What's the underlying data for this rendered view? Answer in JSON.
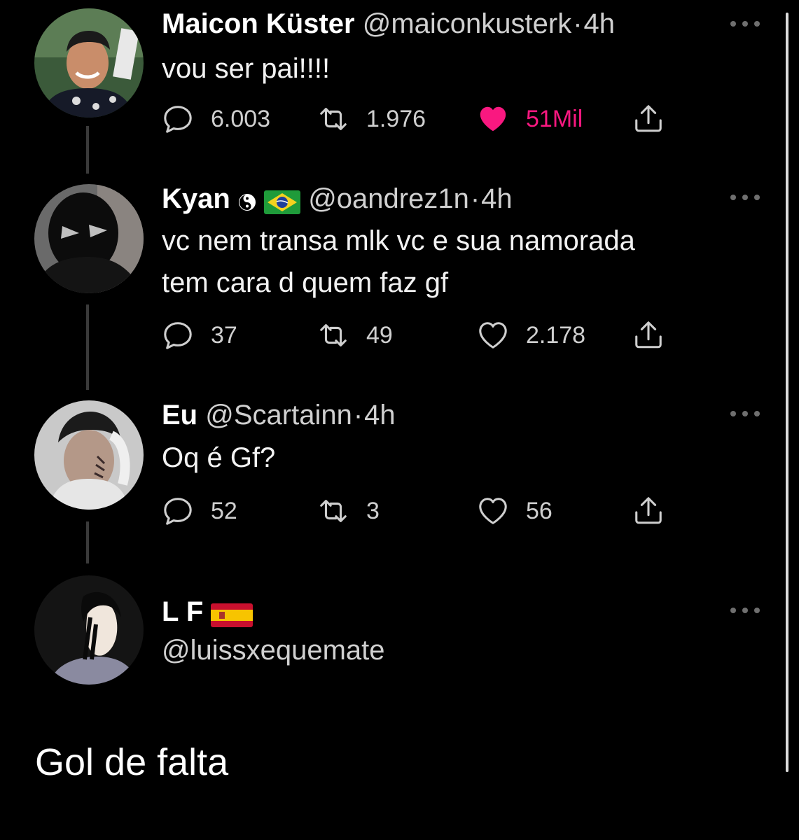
{
  "colors": {
    "background": "#000000",
    "text": "#ffffff",
    "muted": "#cfcfcf",
    "like_active": "#f91880"
  },
  "tweets": [
    {
      "name": "Maicon Küster",
      "handle": "@maiconkusterk",
      "separator": "·",
      "time": "4h",
      "text_lines": [
        "vou ser pai!!!!"
      ],
      "stats": {
        "replies": "6.003",
        "retweets": "1.976",
        "likes": "51Mil"
      },
      "liked": true,
      "badges": []
    },
    {
      "name": "Kyan",
      "handle": "@oandrez1n",
      "separator": "·",
      "time": "4h",
      "text_lines": [
        "vc nem transa mlk vc e sua namorada",
        "tem cara d quem faz gf"
      ],
      "stats": {
        "replies": "37",
        "retweets": "49",
        "likes": "2.178"
      },
      "liked": false,
      "badges": [
        "yin-yang-emoji",
        "brazil-flag-emoji"
      ]
    },
    {
      "name": "Eu",
      "handle": "@Scartainn",
      "separator": "·",
      "time": "4h",
      "text_lines": [
        "Oq é Gf?"
      ],
      "stats": {
        "replies": "52",
        "retweets": "3",
        "likes": "56"
      },
      "liked": false,
      "badges": []
    },
    {
      "name": "L F",
      "handle": "@luissxequemate",
      "badges": [
        "spain-flag-emoji"
      ]
    }
  ],
  "caption": "Gol de falta",
  "icons": [
    "reply-icon",
    "retweet-icon",
    "like-icon",
    "share-icon",
    "more-icon"
  ]
}
